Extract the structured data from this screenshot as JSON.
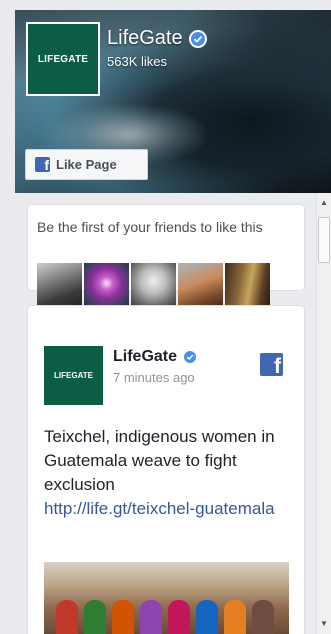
{
  "header": {
    "logo_text": "LIFEGATE",
    "page_name": "LifeGate",
    "likes": "563K likes",
    "like_button_label": "Like Page",
    "fb_icon": "facebook-f-icon",
    "verified_icon": "verified-check-icon"
  },
  "friends": {
    "text": "Be the first of your friends to like this"
  },
  "post": {
    "logo_text": "LIFEGATE",
    "author": "LifeGate",
    "time": "7 minutes ago",
    "text": "Teixchel, indigenous women in Guatemala weave to fight exclusion",
    "link": "http://life.gt/teixchel-guatemala"
  },
  "colors": {
    "brand_green": "#0b5e45",
    "facebook_blue": "#4267b2",
    "link_blue": "#365899",
    "verified_blue": "#4a90e2"
  }
}
